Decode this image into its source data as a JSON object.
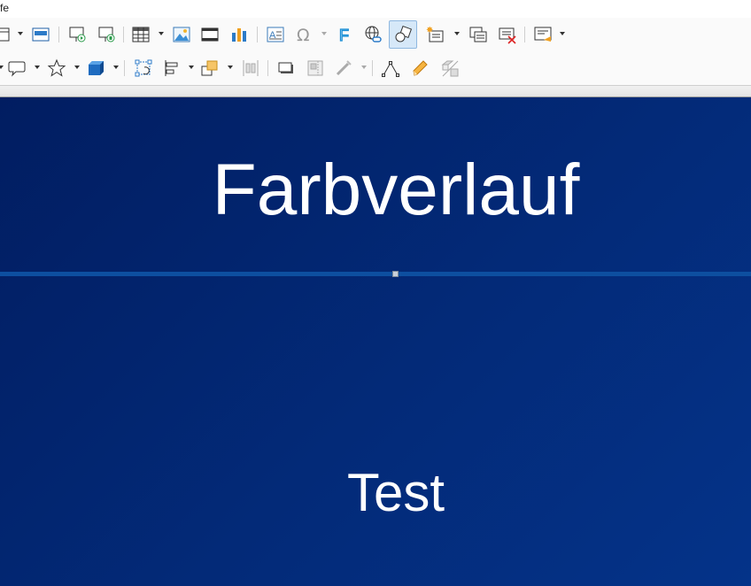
{
  "window": {
    "title_fragment": "fe"
  },
  "toolbar_row1": [
    "page-layout-icon",
    "master-slide-icon",
    "start-presentation-icon",
    "start-from-current-icon",
    "table-icon",
    "image-icon",
    "media-icon",
    "chart-icon",
    "textbox-icon",
    "special-character-icon",
    "fontwork-icon",
    "hyperlink-icon",
    "shapes-icon",
    "new-slide-icon",
    "duplicate-slide-icon",
    "delete-slide-icon",
    "slide-layout-icon"
  ],
  "toolbar_row2": [
    "callout-icon",
    "star-icon",
    "3d-object-icon",
    "rotate-icon",
    "align-icon",
    "arrange-icon",
    "distribute-icon",
    "shadow-icon",
    "crop-icon",
    "filter-icon",
    "points-icon",
    "glue-icon",
    "toggle-extrusion-icon"
  ],
  "slide": {
    "title": "Farbverlauf",
    "body": "Test",
    "colors": {
      "gradient_start": "#011d61",
      "gradient_end": "#043389",
      "divider": "#0d4fa0"
    }
  }
}
